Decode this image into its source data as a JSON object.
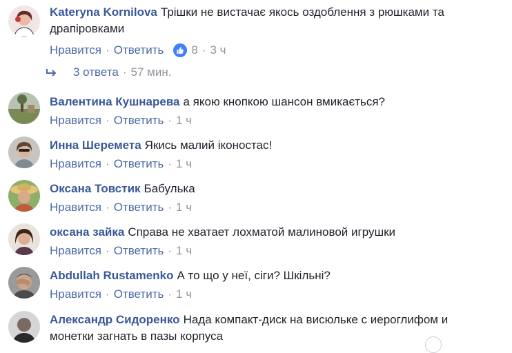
{
  "actions": {
    "like": "Нравится",
    "reply": "Ответить"
  },
  "colors": {
    "author": "#385898",
    "action": "#4b6aa6",
    "meta": "#90949c",
    "text": "#1d2129",
    "like": "#4080ff"
  },
  "comments": [
    {
      "author": "Kateryna Kornilova",
      "text": "Трішки не вистачає якось оздоблення з рюшками та драпіровками",
      "time": "3 ч",
      "likes": "8",
      "avatar": "avatar-woman-icon"
    },
    {
      "author": "Валентина Кушнарева",
      "text": "а якою кнопкою шансон вмикається?",
      "time": "1 ч",
      "avatar": "avatar-landscape-icon"
    },
    {
      "author": "Инна Шеремета",
      "text": "Якись малий іконостас!",
      "time": "1 ч",
      "avatar": "avatar-woman-icon"
    },
    {
      "author": "Оксана Товстик",
      "text": "Бабулька",
      "time": "1 ч",
      "avatar": "avatar-woman-hat-icon"
    },
    {
      "author": "оксана зайка",
      "text": "Справа не хватает лохматой малиновой игрушки",
      "time": "1 ч",
      "avatar": "avatar-woman-icon"
    },
    {
      "author": "Abdullah Rustamenko",
      "text": "А то що у неї, сіги? Шкільні?",
      "time": "1 ч",
      "avatar": "avatar-man-facepalm-icon"
    },
    {
      "author": "Александр Сидоренко",
      "text": "Нада компакт-диск на висюльке с иероглифом и монетки загнать в пазы корпуса",
      "avatar": "avatar-man-icon"
    }
  ],
  "replies": {
    "count_label": "3 ответа",
    "time": "57 мин."
  }
}
